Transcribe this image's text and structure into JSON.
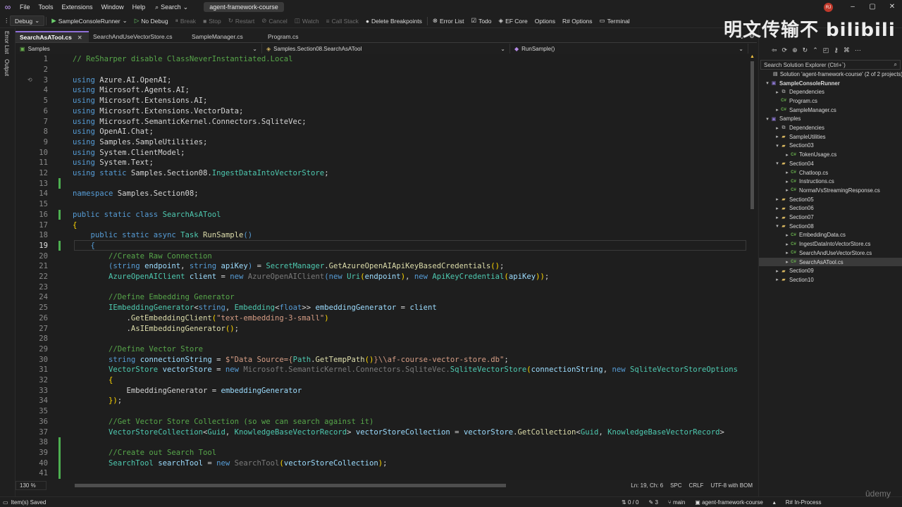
{
  "menu": {
    "items": [
      "File",
      "Tools",
      "Extensions",
      "Window",
      "Help"
    ],
    "search_label": "Search",
    "solution_name": "agent-framework-course",
    "user_initials": "RJ"
  },
  "toolbar": {
    "config": "Debug",
    "startup": "SampleConsoleRunner",
    "no_debug": "No Debug",
    "break": "Break",
    "stop": "Stop",
    "restart": "Restart",
    "cancel": "Cancel",
    "watch": "Watch",
    "call_stack": "Call Stack",
    "delete_breakpoints": "Delete Breakpoints",
    "error_list": "Error List",
    "todo": "Todo",
    "ef_core": "EF Core",
    "options": "Options",
    "rs_options": "R# Options",
    "terminal": "Terminal"
  },
  "left_panel": {
    "error_list": "Error List",
    "output": "Output"
  },
  "tabs": [
    {
      "label": "SearchAsATool.cs",
      "active": true
    },
    {
      "label": "SearchAndUseVectorStore.cs",
      "active": false
    },
    {
      "label": "SampleManager.cs",
      "active": false
    },
    {
      "label": "Program.cs",
      "active": false
    }
  ],
  "navbar": {
    "project": "Samples",
    "type": "Samples.Section08.SearchAsATool",
    "member": "RunSample()"
  },
  "code": [
    {
      "n": "1",
      "tokens": [
        [
          "cm",
          "// ReSharper disable ClassNeverInstantiated.Local"
        ]
      ]
    },
    {
      "n": "2",
      "tokens": []
    },
    {
      "n": "3",
      "tokens": [
        [
          "kw",
          "using "
        ],
        [
          "pl",
          "Azure.AI.OpenAI;"
        ]
      ]
    },
    {
      "n": "4",
      "tokens": [
        [
          "kw",
          "using "
        ],
        [
          "pl",
          "Microsoft.Agents.AI;"
        ]
      ]
    },
    {
      "n": "5",
      "tokens": [
        [
          "kw",
          "using "
        ],
        [
          "pl",
          "Microsoft.Extensions.AI;"
        ]
      ]
    },
    {
      "n": "6",
      "tokens": [
        [
          "kw",
          "using "
        ],
        [
          "pl",
          "Microsoft.Extensions.VectorData;"
        ]
      ]
    },
    {
      "n": "7",
      "tokens": [
        [
          "kw",
          "using "
        ],
        [
          "pl",
          "Microsoft.SemanticKernel.Connectors.SqliteVec;"
        ]
      ]
    },
    {
      "n": "8",
      "tokens": [
        [
          "kw",
          "using "
        ],
        [
          "pl",
          "OpenAI.Chat;"
        ]
      ]
    },
    {
      "n": "9",
      "tokens": [
        [
          "kw",
          "using "
        ],
        [
          "pl",
          "Samples.SampleUtilities;"
        ]
      ]
    },
    {
      "n": "10",
      "tokens": [
        [
          "kw",
          "using "
        ],
        [
          "pl",
          "System.ClientModel;"
        ]
      ]
    },
    {
      "n": "11",
      "tokens": [
        [
          "kw",
          "using "
        ],
        [
          "pl",
          "System.Text;"
        ]
      ]
    },
    {
      "n": "12",
      "tokens": [
        [
          "kw",
          "using static "
        ],
        [
          "pl",
          "Samples.Section08."
        ],
        [
          "ty",
          "IngestDataIntoVectorStore"
        ],
        [
          "pl",
          ";"
        ]
      ]
    },
    {
      "n": "13",
      "tokens": []
    },
    {
      "n": "14",
      "tokens": [
        [
          "kw",
          "namespace "
        ],
        [
          "pl",
          "Samples.Section08;"
        ]
      ]
    },
    {
      "n": "15",
      "tokens": []
    },
    {
      "n": "16",
      "tokens": [
        [
          "kw",
          "public static class "
        ],
        [
          "ty",
          "SearchAsATool"
        ]
      ]
    },
    {
      "n": "17",
      "tokens": [
        [
          "br",
          "{"
        ]
      ]
    },
    {
      "n": "18",
      "tokens": [
        [
          "pl",
          "    "
        ],
        [
          "kw",
          "public static async "
        ],
        [
          "ty",
          "Task "
        ],
        [
          "mt",
          "RunSample"
        ],
        [
          "kw",
          "()"
        ]
      ]
    },
    {
      "n": "19",
      "tokens": [
        [
          "pl",
          "    "
        ],
        [
          "kw",
          "{"
        ]
      ]
    },
    {
      "n": "20",
      "tokens": [
        [
          "pl",
          "        "
        ],
        [
          "cm",
          "//Create Raw Connection"
        ]
      ]
    },
    {
      "n": "21",
      "tokens": [
        [
          "pl",
          "        "
        ],
        [
          "kw",
          "("
        ],
        [
          "kw",
          "string "
        ],
        [
          "vr",
          "endpoint"
        ],
        [
          "pl",
          ", "
        ],
        [
          "kw",
          "string "
        ],
        [
          "vr",
          "apiKey"
        ],
        [
          "kw",
          ")"
        ],
        [
          "pl",
          " = "
        ],
        [
          "ty",
          "SecretManager"
        ],
        [
          "pl",
          "."
        ],
        [
          "mt",
          "GetAzureOpenAIApiKeyBasedCredentials"
        ],
        [
          "br",
          "()"
        ],
        [
          "pl",
          ";"
        ]
      ]
    },
    {
      "n": "22",
      "tokens": [
        [
          "pl",
          "        "
        ],
        [
          "ty",
          "AzureOpenAIClient "
        ],
        [
          "vr",
          "client"
        ],
        [
          "pl",
          " = "
        ],
        [
          "kw",
          "new "
        ],
        [
          "dim",
          "AzureOpenAIClient"
        ],
        [
          "kw",
          "("
        ],
        [
          "kw",
          "new "
        ],
        [
          "ty",
          "Uri"
        ],
        [
          "br",
          "("
        ],
        [
          "vr",
          "endpoint"
        ],
        [
          "br",
          ")"
        ],
        [
          "pl",
          ", "
        ],
        [
          "kw",
          "new "
        ],
        [
          "ty",
          "ApiKeyCredential"
        ],
        [
          "br",
          "("
        ],
        [
          "vr",
          "apiKey"
        ],
        [
          "br",
          "))"
        ],
        [
          "pl",
          ";"
        ]
      ]
    },
    {
      "n": "23",
      "tokens": []
    },
    {
      "n": "24",
      "tokens": [
        [
          "pl",
          "        "
        ],
        [
          "cm",
          "//Define Embedding Generator"
        ]
      ]
    },
    {
      "n": "25",
      "tokens": [
        [
          "pl",
          "        "
        ],
        [
          "ty",
          "IEmbeddingGenerator"
        ],
        [
          "pl",
          "<"
        ],
        [
          "kw",
          "string"
        ],
        [
          "pl",
          ", "
        ],
        [
          "ty",
          "Embedding"
        ],
        [
          "pl",
          "<"
        ],
        [
          "kw",
          "float"
        ],
        [
          "pl",
          ">> "
        ],
        [
          "vr",
          "embeddingGenerator"
        ],
        [
          "pl",
          " = "
        ],
        [
          "vr",
          "client"
        ]
      ]
    },
    {
      "n": "26",
      "tokens": [
        [
          "pl",
          "            ."
        ],
        [
          "mt",
          "GetEmbeddingClient"
        ],
        [
          "br",
          "("
        ],
        [
          "st",
          "\"text-embedding-3-small\""
        ],
        [
          "br",
          ")"
        ]
      ]
    },
    {
      "n": "27",
      "tokens": [
        [
          "pl",
          "            ."
        ],
        [
          "mt",
          "AsIEmbeddingGenerator"
        ],
        [
          "br",
          "()"
        ],
        [
          "pl",
          ";"
        ]
      ]
    },
    {
      "n": "28",
      "tokens": []
    },
    {
      "n": "29",
      "tokens": [
        [
          "pl",
          "        "
        ],
        [
          "cm",
          "//Define Vector Store"
        ]
      ]
    },
    {
      "n": "30",
      "tokens": [
        [
          "pl",
          "        "
        ],
        [
          "kw",
          "string "
        ],
        [
          "vr",
          "connectionString"
        ],
        [
          "pl",
          " = "
        ],
        [
          "st",
          "$\"Data Source="
        ],
        [
          "ip",
          "{"
        ],
        [
          "ty",
          "Path"
        ],
        [
          "pl",
          "."
        ],
        [
          "mt",
          "GetTempPath"
        ],
        [
          "br",
          "()"
        ],
        [
          "ip",
          "}"
        ],
        [
          "st",
          "\\\\af-course-vector-store.db\""
        ],
        [
          "pl",
          ";"
        ]
      ]
    },
    {
      "n": "31",
      "tokens": [
        [
          "pl",
          "        "
        ],
        [
          "ty",
          "VectorStore "
        ],
        [
          "vr",
          "vectorStore"
        ],
        [
          "pl",
          " = "
        ],
        [
          "kw",
          "new "
        ],
        [
          "dim",
          "Microsoft.SemanticKernel.Connectors.SqliteVec."
        ],
        [
          "ty",
          "SqliteVectorStore"
        ],
        [
          "br",
          "("
        ],
        [
          "vr",
          "connectionString"
        ],
        [
          "pl",
          ", "
        ],
        [
          "kw",
          "new "
        ],
        [
          "ty",
          "SqliteVectorStoreOptions"
        ]
      ]
    },
    {
      "n": "32",
      "tokens": [
        [
          "pl",
          "        "
        ],
        [
          "br",
          "{"
        ]
      ]
    },
    {
      "n": "33",
      "tokens": [
        [
          "pl",
          "            EmbeddingGenerator = "
        ],
        [
          "vr",
          "embeddingGenerator"
        ]
      ]
    },
    {
      "n": "34",
      "tokens": [
        [
          "pl",
          "        "
        ],
        [
          "br",
          "})"
        ],
        [
          "pl",
          ";"
        ]
      ]
    },
    {
      "n": "35",
      "tokens": []
    },
    {
      "n": "36",
      "tokens": [
        [
          "pl",
          "        "
        ],
        [
          "cm",
          "//Get Vector Store Collection (so we can search against it)"
        ]
      ]
    },
    {
      "n": "37",
      "tokens": [
        [
          "pl",
          "        "
        ],
        [
          "ty",
          "VectorStoreCollection"
        ],
        [
          "pl",
          "<"
        ],
        [
          "ty",
          "Guid"
        ],
        [
          "pl",
          ", "
        ],
        [
          "ty",
          "KnowledgeBaseVectorRecord"
        ],
        [
          "pl",
          "> "
        ],
        [
          "vr",
          "vectorStoreCollection"
        ],
        [
          "pl",
          " = "
        ],
        [
          "vr",
          "vectorStore"
        ],
        [
          "pl",
          "."
        ],
        [
          "mt",
          "GetCollection"
        ],
        [
          "pl",
          "<"
        ],
        [
          "ty",
          "Guid"
        ],
        [
          "pl",
          ", "
        ],
        [
          "ty",
          "KnowledgeBaseVectorRecord"
        ],
        [
          "pl",
          ">"
        ]
      ]
    },
    {
      "n": "38",
      "tokens": []
    },
    {
      "n": "39",
      "tokens": [
        [
          "pl",
          "        "
        ],
        [
          "cm",
          "//Create out Search Tool"
        ]
      ]
    },
    {
      "n": "40",
      "tokens": [
        [
          "pl",
          "        "
        ],
        [
          "ty",
          "SearchTool "
        ],
        [
          "vr",
          "searchTool"
        ],
        [
          "pl",
          " = "
        ],
        [
          "kw",
          "new "
        ],
        [
          "dim",
          "SearchTool"
        ],
        [
          "br",
          "("
        ],
        [
          "vr",
          "vectorStoreCollection"
        ],
        [
          "br",
          ")"
        ],
        [
          "pl",
          ";"
        ]
      ]
    },
    {
      "n": "41",
      "tokens": []
    }
  ],
  "editor_status": {
    "zoom": "130 %",
    "position": "Ln: 19, Ch: 6",
    "whitespace": "SPC",
    "line_ending": "CRLF",
    "encoding": "UTF-8 with BOM"
  },
  "solution_explorer": {
    "search_placeholder": "Search Solution Explorer (Ctrl+`)",
    "items": [
      {
        "label": "Solution 'agent-framework-course' (2 of 2 projects)",
        "icon": "solution",
        "arrow": "",
        "bold": false
      },
      {
        "label": "SampleConsoleRunner",
        "icon": "proj",
        "arrow": "▾",
        "bold": true
      },
      {
        "label": "Dependencies",
        "icon": "dep",
        "arrow": "▸",
        "bold": false
      },
      {
        "label": "Program.cs",
        "icon": "cs",
        "arrow": "",
        "bold": false
      },
      {
        "label": "SampleManager.cs",
        "icon": "cs",
        "arrow": "▸",
        "bold": false
      },
      {
        "label": "Samples",
        "icon": "proj",
        "arrow": "▾",
        "bold": false
      },
      {
        "label": "Dependencies",
        "icon": "dep",
        "arrow": "▸",
        "bold": false
      },
      {
        "label": "SampleUtilities",
        "icon": "fold",
        "arrow": "▸",
        "bold": false
      },
      {
        "label": "Section03",
        "icon": "fold",
        "arrow": "▾",
        "bold": false
      },
      {
        "label": "TokenUsage.cs",
        "icon": "cs",
        "arrow": "▸",
        "bold": false
      },
      {
        "label": "Section04",
        "icon": "fold",
        "arrow": "▾",
        "bold": false
      },
      {
        "label": "Chatloop.cs",
        "icon": "cs",
        "arrow": "▸",
        "bold": false
      },
      {
        "label": "Instructions.cs",
        "icon": "cs",
        "arrow": "▸",
        "bold": false
      },
      {
        "label": "NormalVsStreamingResponse.cs",
        "icon": "cs",
        "arrow": "▸",
        "bold": false
      },
      {
        "label": "Section05",
        "icon": "fold",
        "arrow": "▸",
        "bold": false
      },
      {
        "label": "Section06",
        "icon": "fold",
        "arrow": "▸",
        "bold": false
      },
      {
        "label": "Section07",
        "icon": "fold",
        "arrow": "▸",
        "bold": false
      },
      {
        "label": "Section08",
        "icon": "fold",
        "arrow": "▾",
        "bold": false
      },
      {
        "label": "EmbeddingData.cs",
        "icon": "cs",
        "arrow": "▸",
        "bold": false
      },
      {
        "label": "IngestDataIntoVectorStore.cs",
        "icon": "cs",
        "arrow": "▸",
        "bold": false
      },
      {
        "label": "SearchAndUseVectorStore.cs",
        "icon": "cs",
        "arrow": "▸",
        "bold": false
      },
      {
        "label": "SearchAsATool.cs",
        "icon": "cs",
        "arrow": "▸",
        "bold": false
      },
      {
        "label": "Section09",
        "icon": "fold",
        "arrow": "▸",
        "bold": false
      },
      {
        "label": "Section10",
        "icon": "fold",
        "arrow": "▸",
        "bold": false
      }
    ]
  },
  "status": {
    "message": "Item(s) Saved",
    "changes": "0 / 0",
    "pending": "3",
    "branch": "main",
    "repo": "agent-framework-course",
    "resharper": "R# In-Process"
  },
  "watermark": {
    "bilibili": "明文传输不 bilibili",
    "udemy": "ûdemy"
  }
}
